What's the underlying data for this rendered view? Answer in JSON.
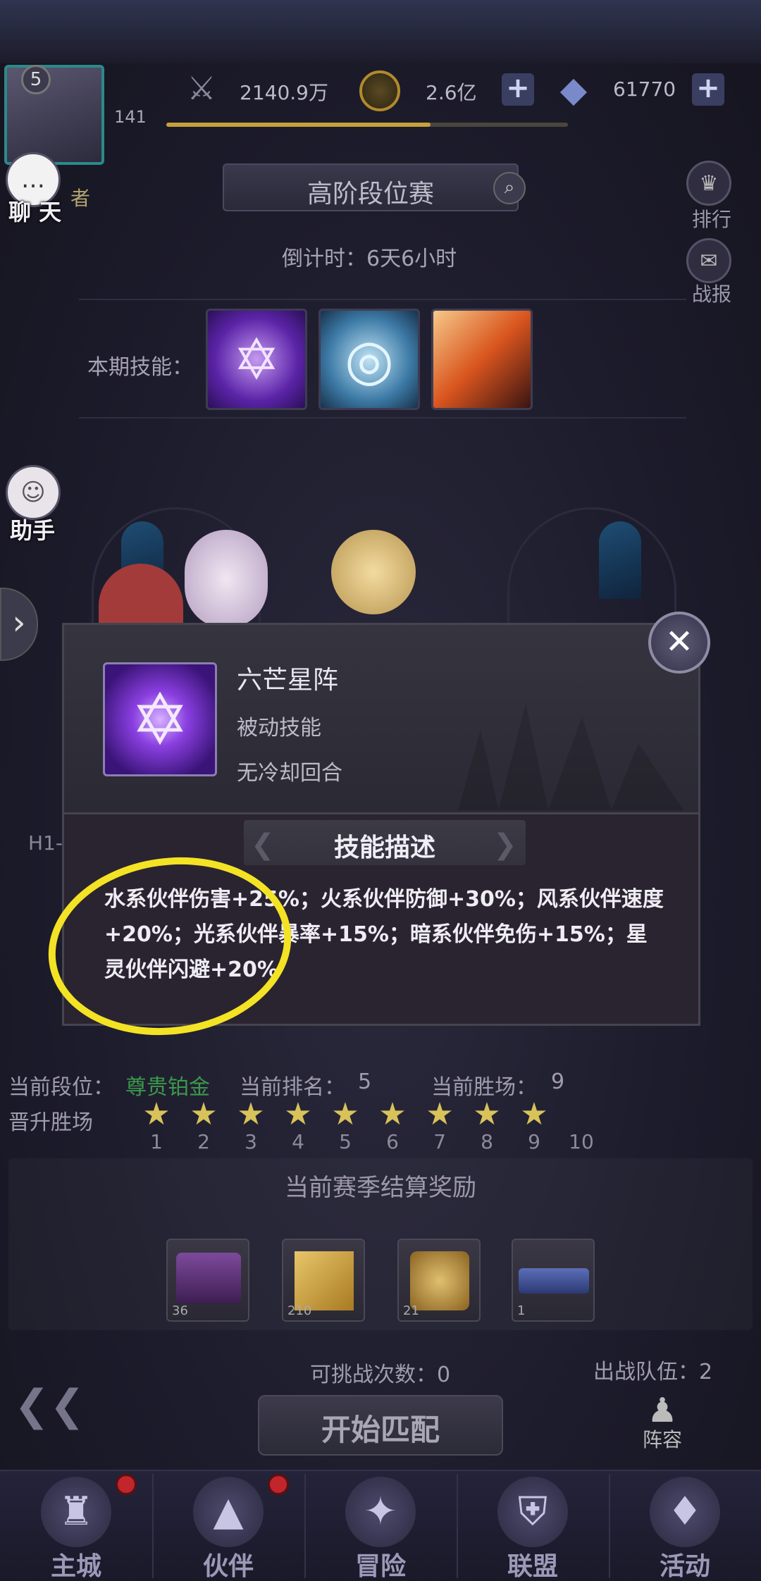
{
  "header": {
    "level": "5",
    "player_number": "141",
    "power": "2140.9万",
    "gold": "2.6亿",
    "diamonds": "61770"
  },
  "left_side": {
    "chat_label": "聊 天",
    "assistant_label": "助手",
    "partial_label": "者"
  },
  "right_side": {
    "ranking_label": "排行",
    "battle_report_label": "战报"
  },
  "event": {
    "title": "高阶段位赛",
    "countdown": "倒计时：6天6小时",
    "skills_label": "本期技能："
  },
  "skill_popup": {
    "name": "六芒星阵",
    "type": "被动技能",
    "cooldown": "无冷却回合",
    "desc_title": "技能描述",
    "description": "水系伙伴伤害+25%；火系伙伴防御+30%；风系伙伴速度+20%；光系伙伴暴率+15%；暗系伙伴免伤+15%；星灵伙伴闪避+20%",
    "partial_bg_text": "H1-"
  },
  "stats": {
    "current_rank_label": "当前段位：",
    "current_rank_value": "尊贵铂金",
    "current_position_label": "当前排名：",
    "current_position_value": "5",
    "current_wins_label": "当前胜场：",
    "current_wins_value": "9",
    "promotion_label": "晋升胜场",
    "stars_filled": 9,
    "stars_numbers": [
      "1",
      "2",
      "3",
      "4",
      "5",
      "6",
      "7",
      "8",
      "9",
      "10"
    ]
  },
  "rewards": {
    "title": "当前赛季结算奖励",
    "items": [
      {
        "count": "36"
      },
      {
        "count": "210"
      },
      {
        "count": "21"
      },
      {
        "count": "1"
      }
    ]
  },
  "match": {
    "challenges_label": "可挑战次数：0",
    "team_label": "出战队伍：2",
    "start_button": "开始匹配",
    "lineup_label": "阵容"
  },
  "nav": {
    "items": [
      {
        "label": "主城",
        "icon": "castle-icon"
      },
      {
        "label": "伙伴",
        "icon": "witch-hat-icon"
      },
      {
        "label": "冒险",
        "icon": "compass-icon"
      },
      {
        "label": "联盟",
        "icon": "shield-icon"
      },
      {
        "label": "活动",
        "icon": "cards-icon"
      }
    ]
  },
  "annotation_color": "#f3e324",
  "accent_colors": {
    "rank_green": "#3b9a4a",
    "star_gold": "#d8c25a",
    "skill_purple": "#8a3fe0"
  }
}
